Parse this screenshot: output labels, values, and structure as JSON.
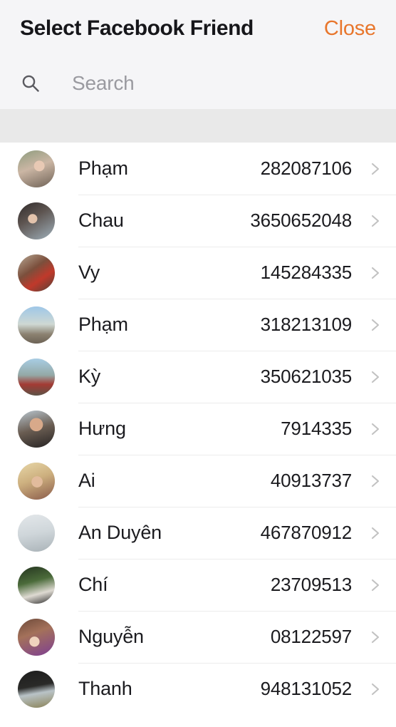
{
  "header": {
    "title": "Select Facebook Friend",
    "close_label": "Close"
  },
  "search": {
    "placeholder": "Search",
    "value": "",
    "icon": "search-icon"
  },
  "list": {
    "chevron_icon": "chevron-right-icon",
    "rows": [
      {
        "name": "Phạm",
        "id": "282087106"
      },
      {
        "name": "Chau",
        "id": "3650652048"
      },
      {
        "name": "Vy",
        "id": "145284335"
      },
      {
        "name": "Phạm",
        "id": "318213109"
      },
      {
        "name": "Kỳ",
        "id": "350621035"
      },
      {
        "name": "Hưng",
        "id": "7914335"
      },
      {
        "name": "Ai",
        "id": "40913737"
      },
      {
        "name": "An Duyên",
        "id": "467870912"
      },
      {
        "name": "Chí",
        "id": "23709513"
      },
      {
        "name": "Nguyễn",
        "id": "08122597"
      },
      {
        "name": "Thanh",
        "id": "948131052"
      }
    ]
  },
  "colors": {
    "accent": "#e8762c",
    "header_bg": "#f5f5f7",
    "band_bg": "#e9e9e9",
    "text": "#1b1b1f",
    "placeholder": "#9a9aa0",
    "chevron": "#c2c2c2",
    "separator": "#ececec"
  }
}
